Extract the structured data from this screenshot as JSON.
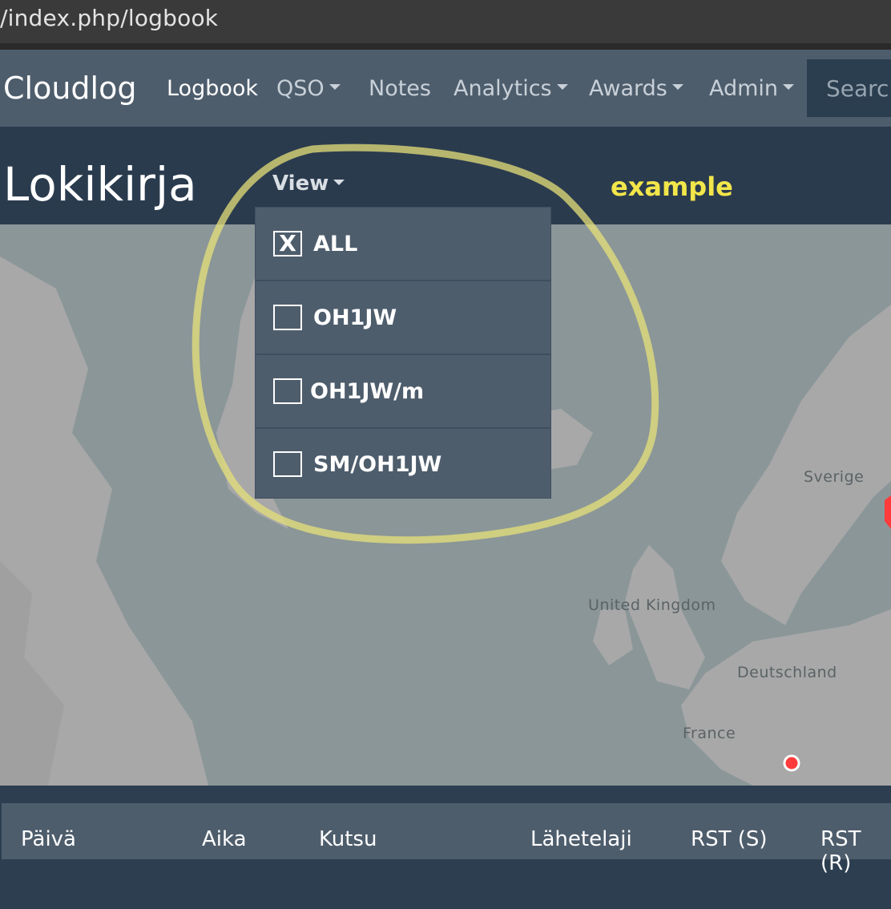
{
  "browser": {
    "url": "/index.php/logbook"
  },
  "navbar": {
    "brand": "Cloudlog",
    "items": [
      {
        "label": "Logbook",
        "dropdown": false,
        "active": true
      },
      {
        "label": "QSO",
        "dropdown": true,
        "active": false
      },
      {
        "label": "Notes",
        "dropdown": false,
        "active": false
      },
      {
        "label": "Analytics",
        "dropdown": true,
        "active": false
      },
      {
        "label": "Awards",
        "dropdown": true,
        "active": false
      },
      {
        "label": "Admin",
        "dropdown": true,
        "active": false
      }
    ],
    "search_placeholder": "Search"
  },
  "page": {
    "title": "Lokikirja",
    "view_label": "View",
    "annotation": "example"
  },
  "view_dropdown": {
    "items": [
      {
        "label": "ALL",
        "checked": true,
        "mark": "X"
      },
      {
        "label": "OH1JW",
        "checked": false,
        "mark": ""
      },
      {
        "label": "OH1JW/m",
        "checked": false,
        "mark": ""
      },
      {
        "label": "SM/OH1JW",
        "checked": false,
        "mark": ""
      }
    ]
  },
  "map": {
    "labels": {
      "sverige": "Sverige",
      "uk": "United Kingdom",
      "deutschland": "Deutschland",
      "france": "France"
    }
  },
  "table": {
    "headers": [
      "Päivä",
      "Aika",
      "Kutsu",
      "Lähetelaji",
      "RST (S)",
      "RST (R)"
    ]
  },
  "colors": {
    "navbar": "#4e5d6c",
    "background": "#2c3e50",
    "map_water": "#8b9698",
    "map_land": "#a9a9a9",
    "annotation": "#f2e64a",
    "marker": "#ff3b3b"
  }
}
